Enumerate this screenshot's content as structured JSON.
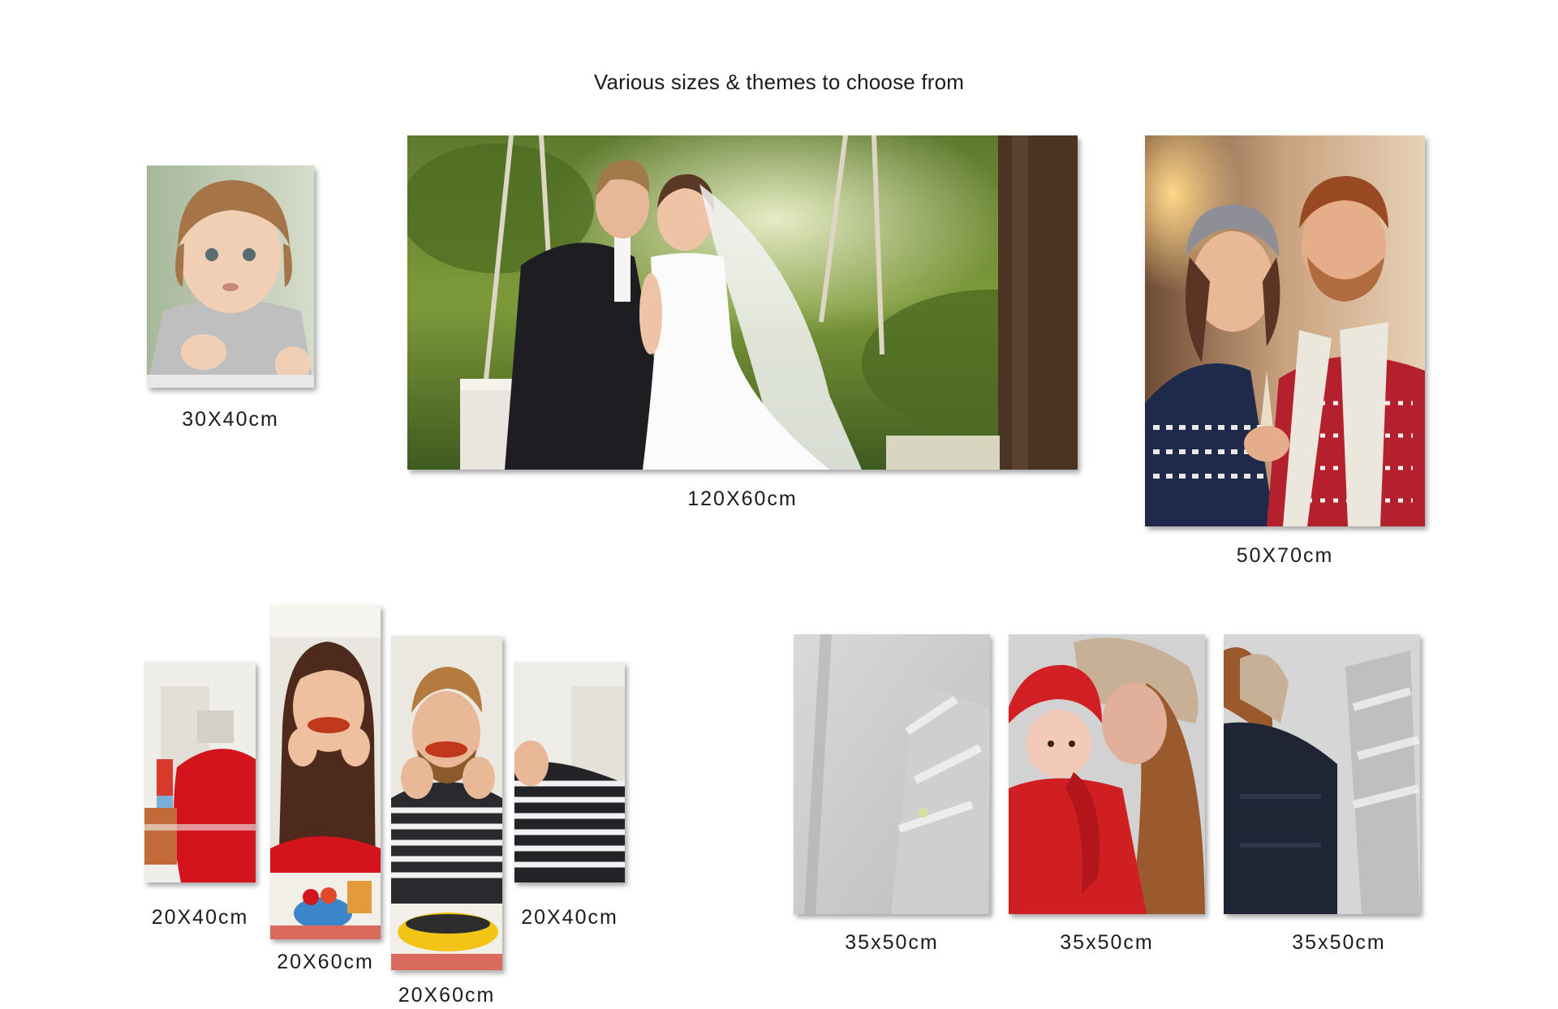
{
  "heading": "Various sizes & themes to choose from",
  "products": {
    "baby": {
      "size": "30X40cm",
      "image": "toddler-portrait"
    },
    "wedding": {
      "size": "120X60cm",
      "image": "couple-on-swing"
    },
    "winter_couple": {
      "size": "50X70cm",
      "image": "couple-in-winter-sweaters"
    },
    "four_panel": {
      "panels": [
        {
          "size": "20X40cm",
          "image": "kitchen-left"
        },
        {
          "size": "20X60cm",
          "image": "woman-eating-chicken-wing"
        },
        {
          "size": "20X60cm",
          "image": "man-eating-chicken-wing"
        },
        {
          "size": "20X40cm",
          "image": "kitchen-right"
        }
      ]
    },
    "three_panel": {
      "panels": [
        {
          "size": "35x50cm",
          "image": "snowy-trees"
        },
        {
          "size": "35x50cm",
          "image": "mother-and-child-in-snow"
        },
        {
          "size": "35x50cm",
          "image": "snowy-forest-jacket"
        }
      ]
    }
  },
  "colors": {
    "text": "#1a1a1a",
    "background": "#ffffff"
  }
}
